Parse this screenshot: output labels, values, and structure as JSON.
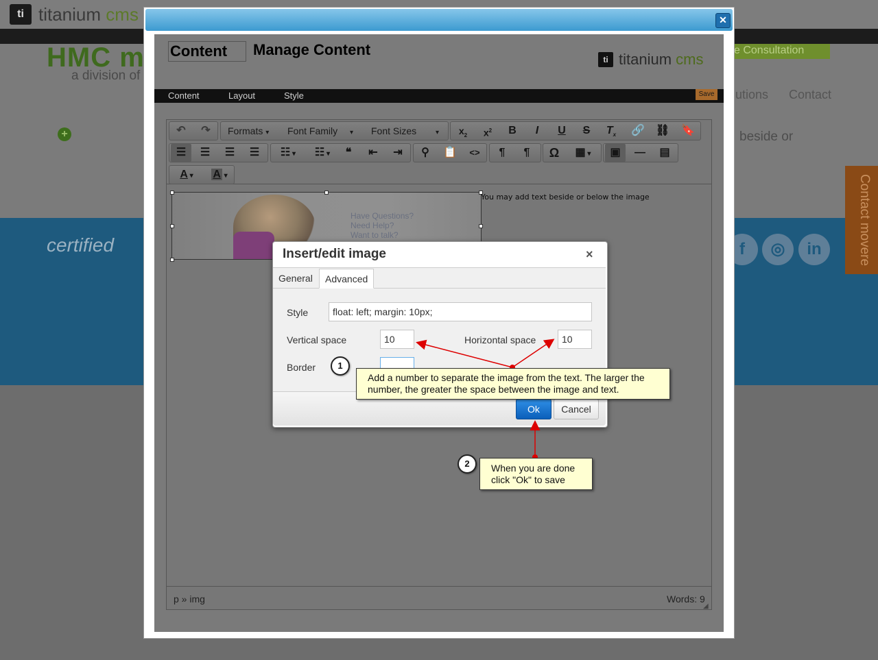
{
  "background_site": {
    "brand_name": "titanium",
    "brand_suffix": "cms",
    "logo_letter": "ti",
    "hmc": "HMC m",
    "division": "a division of",
    "consultation": "e Consultation",
    "nav": [
      "utions",
      "Contact"
    ],
    "beside": "beside or",
    "certified": "certified",
    "contact_tab": "Contact movere",
    "social_icons": [
      "facebook-icon",
      "instagram-icon",
      "linkedin-icon"
    ]
  },
  "cms": {
    "content_image_alt": "Content",
    "page_title": "Manage Content",
    "logo_letter": "ti",
    "logo_text": "titanium",
    "logo_suffix": "cms",
    "menu": [
      "Content",
      "Layout",
      "Style"
    ],
    "save_label": "Save"
  },
  "toolbar": {
    "formats": "Formats",
    "font_family": "Font Family",
    "font_sizes": "Font Sizes"
  },
  "editor": {
    "image_lines": [
      "Have Questions?",
      "Need Help?",
      "Want to talk?"
    ],
    "beside_text": "You may add text beside or below the image",
    "path": "p » img",
    "word_count": "Words: 9"
  },
  "dialog": {
    "title": "Insert/edit image",
    "tabs": [
      "General",
      "Advanced"
    ],
    "active_tab": "Advanced",
    "style_label": "Style",
    "style_value": "float: left; margin: 10px;",
    "vspace_label": "Vertical space",
    "vspace_value": "10",
    "hspace_label": "Horizontal space",
    "hspace_value": "10",
    "border_label": "Border",
    "border_value": "",
    "ok_label": "Ok",
    "cancel_label": "Cancel"
  },
  "callouts": [
    {
      "number": "1",
      "text": "Add a number to separate the image from the text. The larger the number, the greater the space between the image and text."
    },
    {
      "number": "2",
      "text": "When you are done click \"Ok\" to save"
    }
  ],
  "colors": {
    "modal_title_bar": "#3c9ad0",
    "ok_button": "#0b5fba",
    "callout_bg": "#ffffd2",
    "arrow": "#dd0000"
  }
}
